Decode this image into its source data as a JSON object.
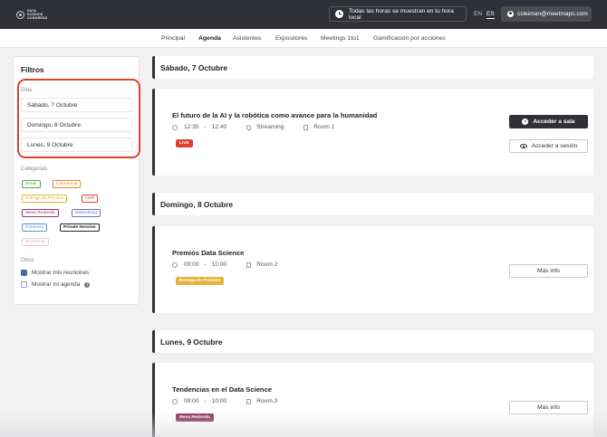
{
  "header": {
    "logo_line1": "DATA",
    "logo_line2": "SCIENCE",
    "logo_line3": "CONGRESS",
    "timezone_notice": "Todas las horas se muestran en tu hora local",
    "lang_en": "EN",
    "lang_es": "ES",
    "user_email": "csleiman@meetmaps.com"
  },
  "nav": {
    "items": [
      "Principal",
      "Agenda",
      "Asistentes",
      "Expositores",
      "Meetings 1to1",
      "Gamificación por acciones"
    ],
    "active": "Agenda"
  },
  "sidebar": {
    "title": "Filtros",
    "days_label": "Días",
    "days": [
      "Sábado, 7 Octubre",
      "Domingo, 8 Octubre",
      "Lunes, 9 Octubre"
    ],
    "categories_label": "Categorías",
    "categories": [
      {
        "label": "Break",
        "color": "#5aa04a"
      },
      {
        "label": "Ceremonia",
        "color": "#e0862c"
      },
      {
        "label": "Entrega de Premios",
        "color": "#e5b43a"
      },
      {
        "label": "LIVE",
        "color": "#d9432f"
      },
      {
        "label": "Mesa Redonda",
        "color": "#8e3a66"
      },
      {
        "label": "Networking",
        "color": "#6e6ec2"
      },
      {
        "label": "Ponencia",
        "color": "#5d8fc9"
      },
      {
        "label": "Private Session",
        "color": "#222222"
      },
      {
        "label": "Workshop",
        "color": "#eab0b0"
      }
    ],
    "others_label": "Otros",
    "show_meetings": "Mostrar mis reuniones",
    "show_agenda": "Mostrar mi agenda",
    "info_symbol": "i"
  },
  "days": [
    {
      "heading": "Sábado, 7 Octubre",
      "session": {
        "title": "El futuro de la AI y la robótica como avance para la humanidad",
        "start": "12:35",
        "end": "12:40",
        "location": "Streaming",
        "room": "Room 1",
        "badge": "LIVE",
        "badge_color": "#d9432f",
        "primary_button": "Acceder a sala",
        "secondary_button": "Acceder a sesión"
      }
    },
    {
      "heading": "Domingo, 8 Octubre",
      "session": {
        "title": "Premios Data Science",
        "start": "09:00",
        "end": "10:00",
        "room": "Room 2",
        "badge": "Entrega de Premios",
        "badge_color": "#e5b43a",
        "secondary_button": "Más info"
      }
    },
    {
      "heading": "Lunes, 9 Octubre",
      "session": {
        "title": "Tendencias en el Data Science",
        "start": "09:00",
        "end": "10:00",
        "room": "Room.3",
        "badge": "Mesa Redonda",
        "badge_color": "#8e3a66",
        "secondary_button": "Más info"
      }
    }
  ],
  "time_separator": "-"
}
